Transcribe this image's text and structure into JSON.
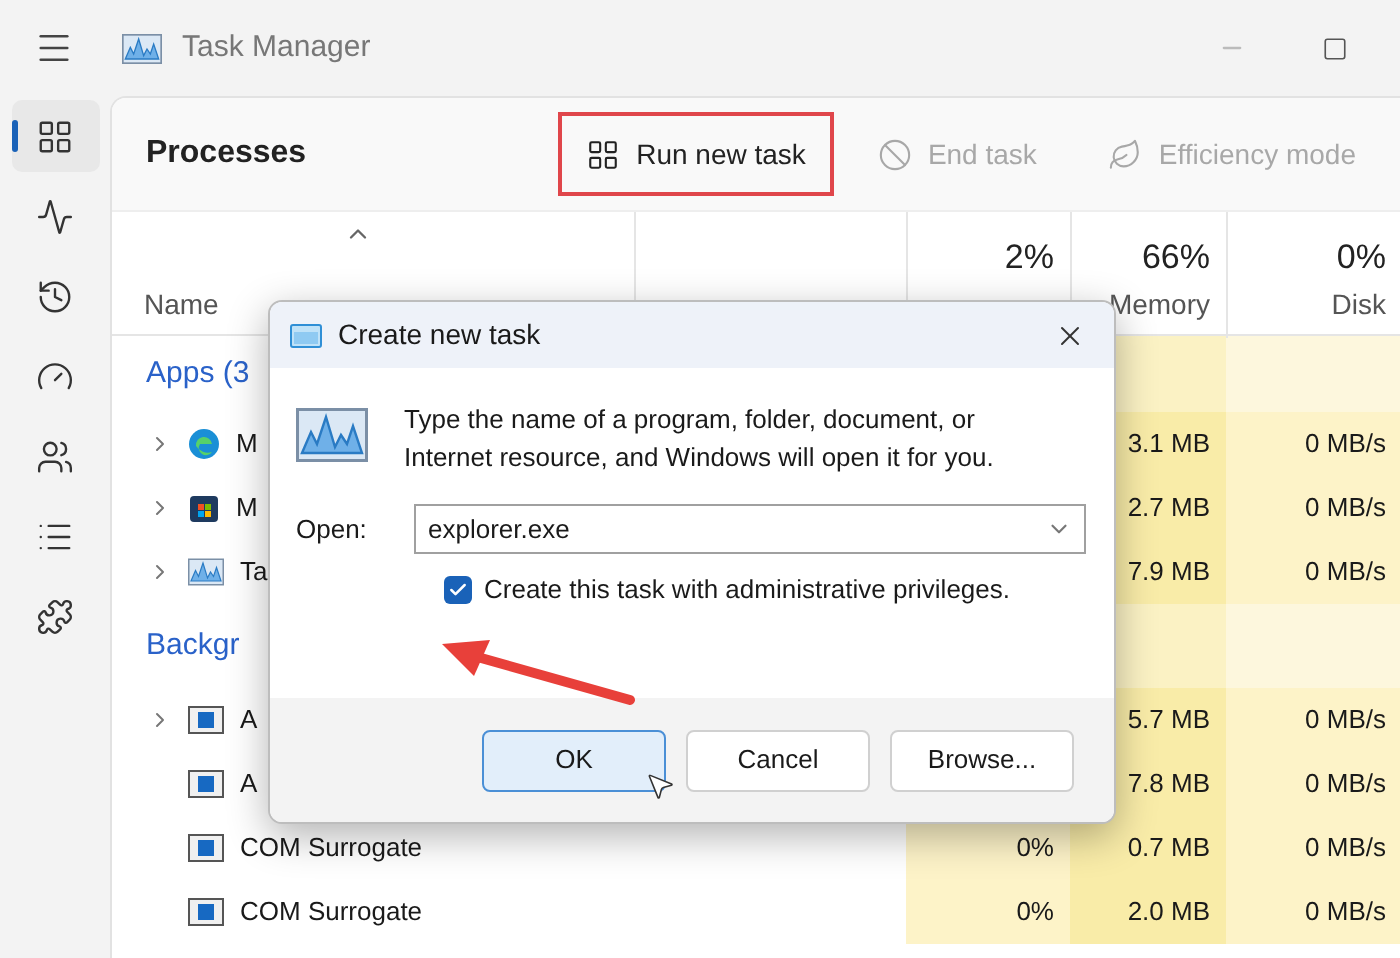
{
  "window": {
    "title": "Task Manager"
  },
  "sidebar": {
    "items": [
      {
        "selected": true
      },
      {
        "selected": false
      },
      {
        "selected": false
      },
      {
        "selected": false
      },
      {
        "selected": false
      },
      {
        "selected": false
      },
      {
        "selected": false
      }
    ]
  },
  "page_title": "Processes",
  "toolbar": [
    {
      "label": "Run new task",
      "disabled": false,
      "highlighted": true
    },
    {
      "label": "End task",
      "disabled": true,
      "highlighted": false
    },
    {
      "label": "Efficiency mode",
      "disabled": true,
      "highlighted": false
    }
  ],
  "table": {
    "columns": [
      {
        "label": "Name"
      },
      {},
      {
        "usage": "2%"
      },
      {
        "label": "Memory",
        "usage": "66%"
      },
      {
        "label": "Disk",
        "usage": "0%"
      }
    ],
    "groups": [
      {
        "title": "Apps (3",
        "rows": [
          {
            "name": "M",
            "expandable": true,
            "memory": "3.1 MB",
            "disk": "0 MB/s"
          },
          {
            "name": "M",
            "expandable": true,
            "memory": "2.7 MB",
            "disk": "0 MB/s"
          },
          {
            "name": "Ta",
            "expandable": true,
            "memory": "7.9 MB",
            "disk": "0 MB/s"
          }
        ]
      },
      {
        "title": "Backgr",
        "rows": [
          {
            "name": "A",
            "expandable": true,
            "memory": "5.7 MB",
            "disk": "0 MB/s"
          },
          {
            "name": "A",
            "expandable": false,
            "memory": "7.8 MB",
            "disk": "0 MB/s"
          },
          {
            "name": "COM Surrogate",
            "expandable": false,
            "cpu": "0%",
            "memory": "0.7 MB",
            "disk": "0 MB/s"
          },
          {
            "name": "COM Surrogate",
            "expandable": false,
            "cpu": "0%",
            "memory": "2.0 MB",
            "disk": "0 MB/s"
          }
        ]
      }
    ]
  },
  "dialog": {
    "title": "Create new task",
    "message": "Type the name of a program, folder, document, or Internet resource, and Windows will open it for you.",
    "open_label": "Open:",
    "open_value": "explorer.exe",
    "admin": {
      "label": "Create this task with administrative privileges.",
      "checked": true
    },
    "buttons": [
      {
        "label": "OK",
        "default": true
      },
      {
        "label": "Cancel",
        "default": false
      },
      {
        "label": "Browse...",
        "default": false
      }
    ]
  }
}
